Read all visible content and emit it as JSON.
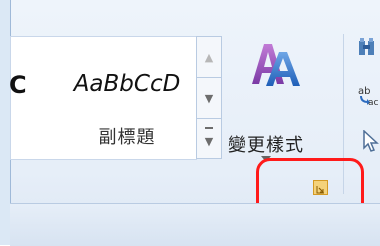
{
  "styles_gallery": {
    "items": [
      {
        "preview": "C",
        "name": ""
      },
      {
        "preview": "AaBbCcD",
        "name": "副標題"
      }
    ]
  },
  "change_styles": {
    "label": "變更樣式"
  },
  "icons": {
    "change_styles": "change-styles-aa-icon",
    "find": "find-icon",
    "replace": "replace-icon",
    "select": "select-cursor-icon",
    "launcher": "dialog-launcher-icon"
  },
  "colors": {
    "highlight": "#ff1a1a",
    "launcher_fill": "#f4d27a",
    "ribbon_bg": "#e6eef8"
  }
}
